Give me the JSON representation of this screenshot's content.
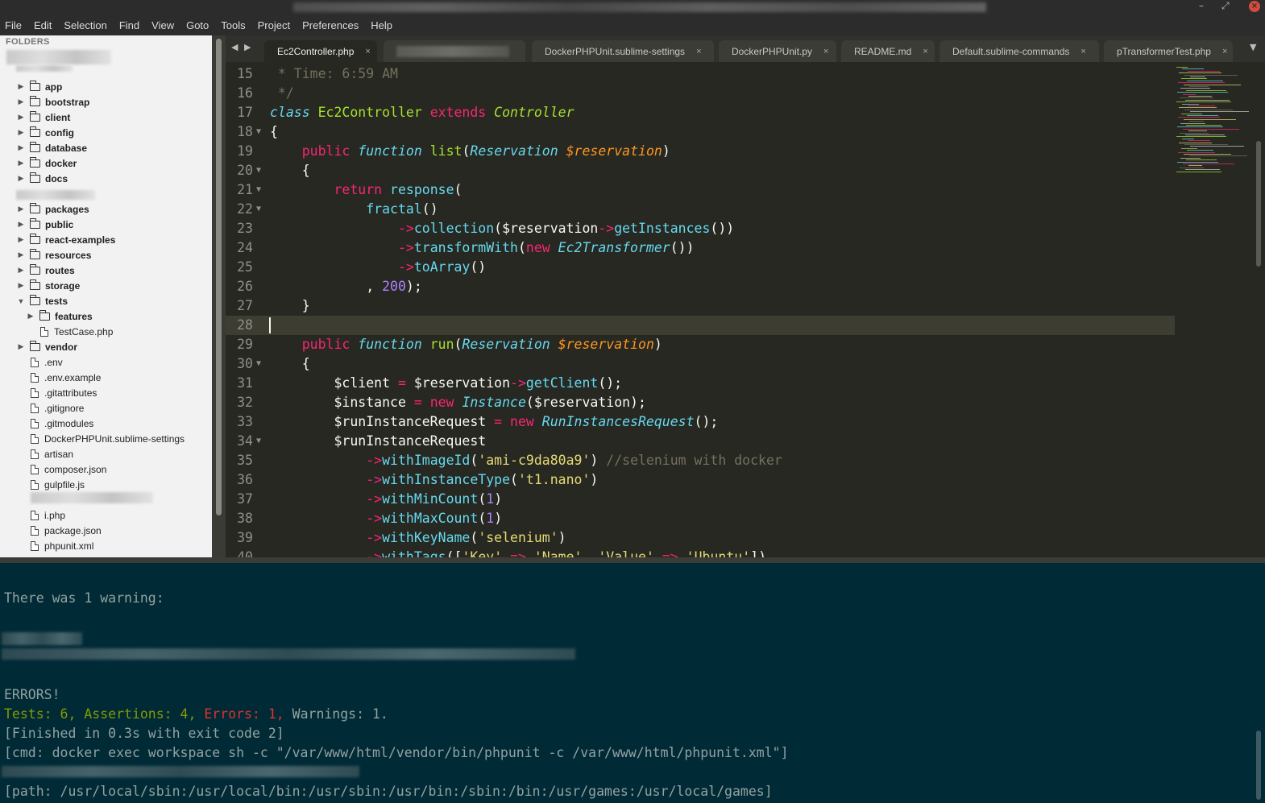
{
  "window": {
    "minimize_glyph": "–",
    "maximize_glyph": "⤢",
    "close_glyph": "×"
  },
  "menu": [
    "File",
    "Edit",
    "Selection",
    "Find",
    "View",
    "Goto",
    "Tools",
    "Project",
    "Preferences",
    "Help"
  ],
  "sidebar": {
    "header": "FOLDERS",
    "items": [
      {
        "label": "app",
        "type": "folder",
        "depth": 0,
        "expanded": false
      },
      {
        "label": "bootstrap",
        "type": "folder",
        "depth": 0,
        "expanded": false
      },
      {
        "label": "client",
        "type": "folder",
        "depth": 0,
        "expanded": false
      },
      {
        "label": "config",
        "type": "folder",
        "depth": 0,
        "expanded": false
      },
      {
        "label": "database",
        "type": "folder",
        "depth": 0,
        "expanded": false
      },
      {
        "label": "docker",
        "type": "folder",
        "depth": 0,
        "expanded": false
      },
      {
        "label": "docs",
        "type": "folder",
        "depth": 0,
        "expanded": false
      },
      {
        "label": "packages",
        "type": "folder",
        "depth": 0,
        "expanded": false
      },
      {
        "label": "public",
        "type": "folder",
        "depth": 0,
        "expanded": false
      },
      {
        "label": "react-examples",
        "type": "folder",
        "depth": 0,
        "expanded": false
      },
      {
        "label": "resources",
        "type": "folder",
        "depth": 0,
        "expanded": false
      },
      {
        "label": "routes",
        "type": "folder",
        "depth": 0,
        "expanded": false
      },
      {
        "label": "storage",
        "type": "folder",
        "depth": 0,
        "expanded": false
      },
      {
        "label": "tests",
        "type": "folder",
        "depth": 0,
        "expanded": true
      },
      {
        "label": "features",
        "type": "folder",
        "depth": 1,
        "expanded": false
      },
      {
        "label": "TestCase.php",
        "type": "file",
        "depth": 1
      },
      {
        "label": "vendor",
        "type": "folder",
        "depth": 0,
        "expanded": false
      },
      {
        "label": ".env",
        "type": "file",
        "depth": 0
      },
      {
        "label": ".env.example",
        "type": "file",
        "depth": 0
      },
      {
        "label": ".gitattributes",
        "type": "file",
        "depth": 0
      },
      {
        "label": ".gitignore",
        "type": "file",
        "depth": 0
      },
      {
        "label": ".gitmodules",
        "type": "file",
        "depth": 0
      },
      {
        "label": "DockerPHPUnit.sublime-settings",
        "type": "file",
        "depth": 0
      },
      {
        "label": "artisan",
        "type": "file",
        "depth": 0
      },
      {
        "label": "composer.json",
        "type": "file",
        "depth": 0
      },
      {
        "label": "gulpfile.js",
        "type": "file",
        "depth": 0
      },
      {
        "label": "i.php",
        "type": "file",
        "depth": 0
      },
      {
        "label": "package.json",
        "type": "file",
        "depth": 0
      },
      {
        "label": "phpunit.xml",
        "type": "file",
        "depth": 0
      }
    ]
  },
  "tabs": {
    "nav_prev": "◀",
    "nav_next": "▶",
    "overflow": "▼",
    "items": [
      {
        "label": "Ec2Controller.php",
        "active": true
      },
      {
        "label": "",
        "active": false
      },
      {
        "label": "DockerPHPUnit.sublime-settings",
        "active": false
      },
      {
        "label": "DockerPHPUnit.py",
        "active": false
      },
      {
        "label": "README.md",
        "active": false
      },
      {
        "label": "Default.sublime-commands",
        "active": false
      },
      {
        "label": "pTransformerTest.php",
        "active": false
      }
    ],
    "close_glyph": "×"
  },
  "editor": {
    "current_line": 28,
    "lines": [
      {
        "n": 15,
        "fold": false,
        "tokens": [
          [
            " * Time: 6:59 AM",
            "cmt"
          ]
        ]
      },
      {
        "n": 16,
        "fold": false,
        "tokens": [
          [
            " */",
            "cmt"
          ]
        ]
      },
      {
        "n": 17,
        "fold": false,
        "tokens": [
          [
            "class",
            "st"
          ],
          [
            " ",
            ""
          ],
          [
            "Ec2Controller",
            "fn"
          ],
          [
            " ",
            ""
          ],
          [
            "extends",
            "kw"
          ],
          [
            " ",
            ""
          ],
          [
            "Controller",
            "cls"
          ]
        ]
      },
      {
        "n": 18,
        "fold": true,
        "tokens": [
          [
            "{",
            ""
          ]
        ]
      },
      {
        "n": 19,
        "fold": false,
        "tokens": [
          [
            "    ",
            ""
          ],
          [
            "public",
            "kw"
          ],
          [
            " ",
            ""
          ],
          [
            "function",
            "st"
          ],
          [
            " ",
            ""
          ],
          [
            "list",
            "fn"
          ],
          [
            "(",
            ""
          ],
          [
            "Reservation",
            "ty"
          ],
          [
            " ",
            ""
          ],
          [
            "$reservation",
            "var"
          ],
          [
            ")",
            ""
          ]
        ]
      },
      {
        "n": 20,
        "fold": true,
        "tokens": [
          [
            "    {",
            ""
          ]
        ]
      },
      {
        "n": 21,
        "fold": true,
        "tokens": [
          [
            "        ",
            ""
          ],
          [
            "return",
            "kw"
          ],
          [
            " ",
            ""
          ],
          [
            "response",
            "call"
          ],
          [
            "(",
            ""
          ]
        ]
      },
      {
        "n": 22,
        "fold": true,
        "tokens": [
          [
            "            ",
            ""
          ],
          [
            "fractal",
            "call"
          ],
          [
            "()",
            ""
          ]
        ]
      },
      {
        "n": 23,
        "fold": false,
        "tokens": [
          [
            "                ",
            ""
          ],
          [
            "->",
            "kw"
          ],
          [
            "collection",
            "call"
          ],
          [
            "($reservation",
            ""
          ],
          [
            "->",
            "kw"
          ],
          [
            "getInstances",
            "call"
          ],
          [
            "())",
            ""
          ]
        ]
      },
      {
        "n": 24,
        "fold": false,
        "tokens": [
          [
            "                ",
            ""
          ],
          [
            "->",
            "kw"
          ],
          [
            "transformWith",
            "call"
          ],
          [
            "(",
            ""
          ],
          [
            "new",
            "kw"
          ],
          [
            " ",
            ""
          ],
          [
            "Ec2Transformer",
            "ty"
          ],
          [
            "())",
            ""
          ]
        ]
      },
      {
        "n": 25,
        "fold": false,
        "tokens": [
          [
            "                ",
            ""
          ],
          [
            "->",
            "kw"
          ],
          [
            "toArray",
            "call"
          ],
          [
            "()",
            ""
          ]
        ]
      },
      {
        "n": 26,
        "fold": false,
        "tokens": [
          [
            "            , ",
            ""
          ],
          [
            "200",
            "num-lit"
          ],
          [
            ");",
            ""
          ]
        ]
      },
      {
        "n": 27,
        "fold": false,
        "tokens": [
          [
            "    }",
            ""
          ]
        ]
      },
      {
        "n": 28,
        "fold": false,
        "tokens": []
      },
      {
        "n": 29,
        "fold": false,
        "tokens": [
          [
            "    ",
            ""
          ],
          [
            "public",
            "kw"
          ],
          [
            " ",
            ""
          ],
          [
            "function",
            "st"
          ],
          [
            " ",
            ""
          ],
          [
            "run",
            "fn"
          ],
          [
            "(",
            ""
          ],
          [
            "Reservation",
            "ty"
          ],
          [
            " ",
            ""
          ],
          [
            "$reservation",
            "var"
          ],
          [
            ")",
            ""
          ]
        ]
      },
      {
        "n": 30,
        "fold": true,
        "tokens": [
          [
            "    {",
            ""
          ]
        ]
      },
      {
        "n": 31,
        "fold": false,
        "tokens": [
          [
            "        $client ",
            ""
          ],
          [
            "=",
            "kw"
          ],
          [
            " $reservation",
            ""
          ],
          [
            "->",
            "kw"
          ],
          [
            "getClient",
            "call"
          ],
          [
            "();",
            ""
          ]
        ]
      },
      {
        "n": 32,
        "fold": false,
        "tokens": [
          [
            "        $instance ",
            ""
          ],
          [
            "=",
            "kw"
          ],
          [
            " ",
            ""
          ],
          [
            "new",
            "kw"
          ],
          [
            " ",
            ""
          ],
          [
            "Instance",
            "ty"
          ],
          [
            "($reservation);",
            ""
          ]
        ]
      },
      {
        "n": 33,
        "fold": false,
        "tokens": [
          [
            "        $runInstanceRequest ",
            ""
          ],
          [
            "=",
            "kw"
          ],
          [
            " ",
            ""
          ],
          [
            "new",
            "kw"
          ],
          [
            " ",
            ""
          ],
          [
            "RunInstancesRequest",
            "ty"
          ],
          [
            "();",
            ""
          ]
        ]
      },
      {
        "n": 34,
        "fold": true,
        "tokens": [
          [
            "        $runInstanceRequest",
            ""
          ]
        ]
      },
      {
        "n": 35,
        "fold": false,
        "tokens": [
          [
            "            ",
            ""
          ],
          [
            "->",
            "kw"
          ],
          [
            "withImageId",
            "call"
          ],
          [
            "(",
            ""
          ],
          [
            "'ami-c9da80a9'",
            "str"
          ],
          [
            ") ",
            ""
          ],
          [
            "//selenium with docker",
            "cmt"
          ]
        ]
      },
      {
        "n": 36,
        "fold": false,
        "tokens": [
          [
            "            ",
            ""
          ],
          [
            "->",
            "kw"
          ],
          [
            "withInstanceType",
            "call"
          ],
          [
            "(",
            ""
          ],
          [
            "'t1.nano'",
            "str"
          ],
          [
            ")",
            ""
          ]
        ]
      },
      {
        "n": 37,
        "fold": false,
        "tokens": [
          [
            "            ",
            ""
          ],
          [
            "->",
            "kw"
          ],
          [
            "withMinCount",
            "call"
          ],
          [
            "(",
            ""
          ],
          [
            "1",
            "num-lit"
          ],
          [
            ")",
            ""
          ]
        ]
      },
      {
        "n": 38,
        "fold": false,
        "tokens": [
          [
            "            ",
            ""
          ],
          [
            "->",
            "kw"
          ],
          [
            "withMaxCount",
            "call"
          ],
          [
            "(",
            ""
          ],
          [
            "1",
            "num-lit"
          ],
          [
            ")",
            ""
          ]
        ]
      },
      {
        "n": 39,
        "fold": false,
        "tokens": [
          [
            "            ",
            ""
          ],
          [
            "->",
            "kw"
          ],
          [
            "withKeyName",
            "call"
          ],
          [
            "(",
            ""
          ],
          [
            "'selenium'",
            "str"
          ],
          [
            ")",
            ""
          ]
        ]
      },
      {
        "n": 40,
        "fold": false,
        "tokens": [
          [
            "            ",
            ""
          ],
          [
            "->",
            "kw"
          ],
          [
            "withTags",
            "call"
          ],
          [
            "([",
            ""
          ],
          [
            "'Key'",
            "str"
          ],
          [
            " ",
            ""
          ],
          [
            "=>",
            "kw"
          ],
          [
            " ",
            ""
          ],
          [
            "'Name'",
            "str"
          ],
          [
            ", ",
            ""
          ],
          [
            "'Value'",
            "str"
          ],
          [
            " ",
            ""
          ],
          [
            "=>",
            "kw"
          ],
          [
            " ",
            ""
          ],
          [
            "'Ubuntu'",
            "str"
          ],
          [
            "])",
            ""
          ]
        ]
      }
    ]
  },
  "output": {
    "warning_line": "There was 1 warning:",
    "errors_header": "ERRORS!",
    "summary": {
      "tests": "Tests: 6, Assertions: 4, ",
      "errors": "Errors: 1,",
      "warnings": " Warnings: 1."
    },
    "finished": "[Finished in 0.3s with exit code 2]",
    "cmd": "[cmd: docker exec workspace sh -c \"/var/www/html/vendor/bin/phpunit -c /var/www/html/phpunit.xml\"]",
    "path": "[path: /usr/local/sbin:/usr/local/bin:/usr/sbin:/usr/bin:/sbin:/bin:/usr/games:/usr/local/games]"
  },
  "colors": {
    "editor_bg": "#272822",
    "output_bg": "#002b36",
    "sidebar_bg": "#f2f2f2"
  }
}
